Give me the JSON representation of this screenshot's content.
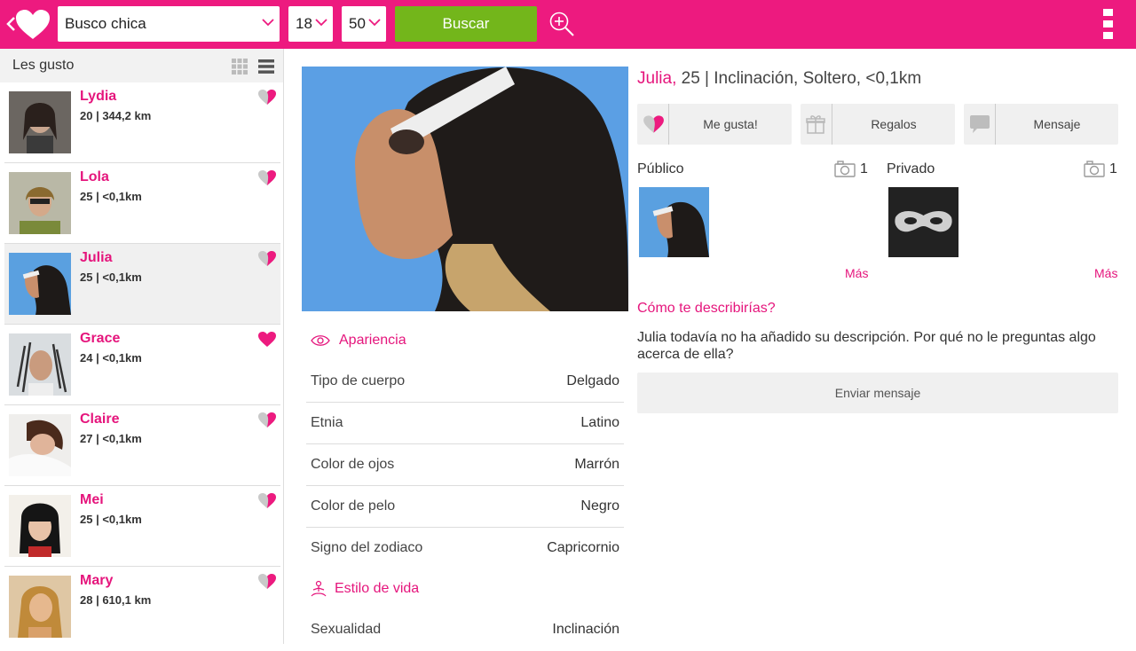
{
  "topbar": {
    "looking_for": "Busco chica",
    "age_min": "18",
    "age_max": "50",
    "search_label": "Buscar"
  },
  "sidebar": {
    "title": "Les gusto",
    "items": [
      {
        "name": "Lydia",
        "info": "20 | 344,2 km",
        "liked": false
      },
      {
        "name": "Lola",
        "info": "25 | <0,1km",
        "liked": false
      },
      {
        "name": "Julia",
        "info": "25 | <0,1km",
        "liked": false,
        "active": true
      },
      {
        "name": "Grace",
        "info": "24 | <0,1km",
        "liked": true
      },
      {
        "name": "Claire",
        "info": "27 | <0,1km",
        "liked": false
      },
      {
        "name": "Mei",
        "info": "25 | <0,1km",
        "liked": false
      },
      {
        "name": "Mary",
        "info": "28 | 610,1 km",
        "liked": false
      }
    ]
  },
  "profile": {
    "name": "Julia,",
    "summary": " 25 | Inclinación, Soltero, <0,1km",
    "actions": {
      "like": "Me gusta!",
      "gifts": "Regalos",
      "message": "Mensaje"
    },
    "gallery": {
      "public_label": "Público",
      "public_count": "1",
      "private_label": "Privado",
      "private_count": "1",
      "more": "Más"
    },
    "appearance": {
      "title": "Apariencia",
      "rows": [
        {
          "label": "Tipo de cuerpo",
          "value": "Delgado"
        },
        {
          "label": "Etnia",
          "value": "Latino"
        },
        {
          "label": "Color de ojos",
          "value": "Marrón"
        },
        {
          "label": "Color de pelo",
          "value": "Negro"
        },
        {
          "label": "Signo del zodiaco",
          "value": "Capricornio"
        }
      ]
    },
    "lifestyle": {
      "title": "Estilo de vida",
      "rows": [
        {
          "label": "Sexualidad",
          "value": "Inclinación"
        }
      ]
    },
    "describe_question": "Cómo te describirías?",
    "describe_text": "Julia todavía no ha añadido su descripción. Por qué no le preguntas algo acerca de ella?",
    "send_message": "Enviar mensaje"
  },
  "colors": {
    "brand": "#ed1a7f",
    "accent_text": "#e5157c",
    "search_button": "#73b61b"
  },
  "icons": [
    "back-chevron-icon",
    "heart-logo-icon",
    "chevron-down-icon",
    "zoom-in-icon",
    "overflow-menu-icon",
    "grid-view-icon",
    "list-view-icon",
    "heart-icon",
    "eye-icon",
    "lotus-icon",
    "gift-icon",
    "chat-bubble-icon",
    "camera-icon",
    "mask-icon"
  ]
}
